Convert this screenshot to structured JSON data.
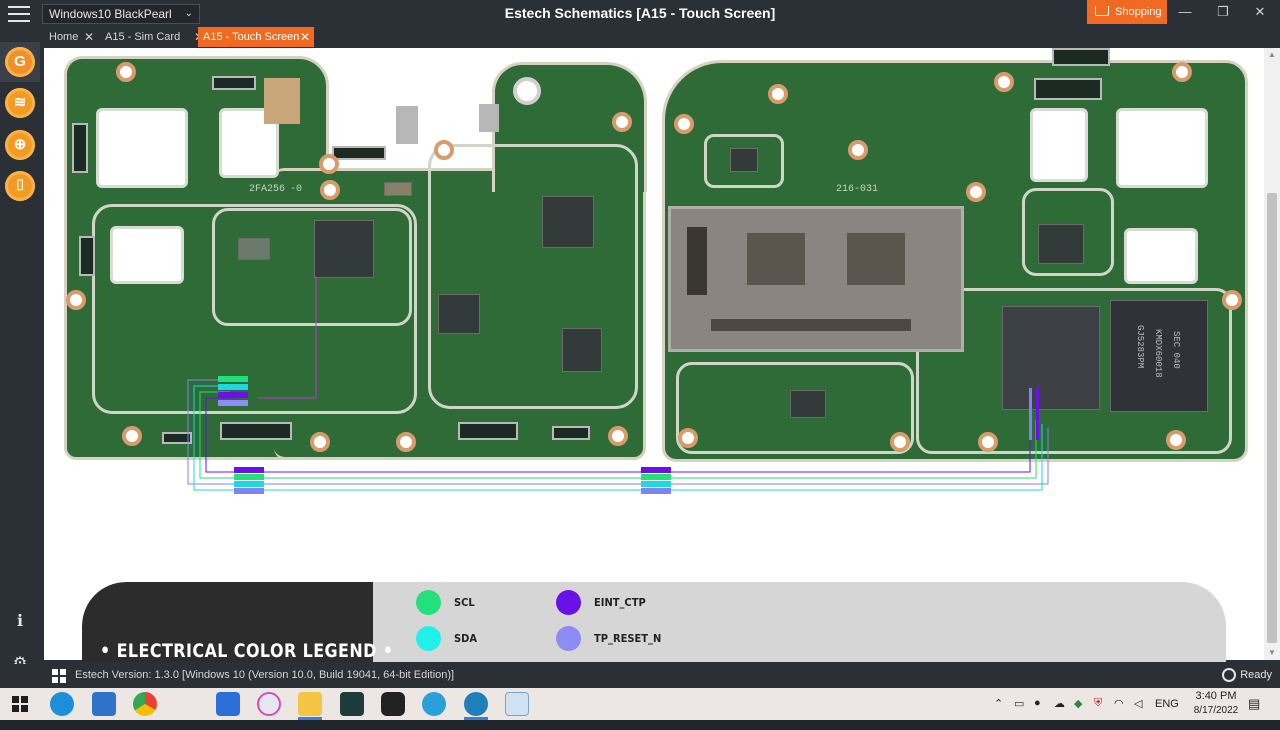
{
  "window": {
    "title": "Estech Schematics [A15 - Touch Screen]",
    "profile_select": "Windows10 BlackPearl",
    "shopping_label": "Shopping",
    "controls": {
      "minimize": "—",
      "maximize": "❐",
      "close": "✕"
    }
  },
  "tabs": [
    {
      "label": "Home",
      "active": false
    },
    {
      "label": "A15 - Sim Card",
      "active": false
    },
    {
      "label": "A15 - Touch Screen",
      "active": true
    }
  ],
  "sidebar": {
    "buttons": [
      "G",
      "≋",
      "⊕",
      "⌷"
    ],
    "bottom": {
      "info": "ℹ",
      "settings": "⚙"
    }
  },
  "board": {
    "silk_left_1": "2FA256",
    "silk_left_2": "-0",
    "silk_right_1": "216-031",
    "chip_mark_1": "SEC 040",
    "chip_mark_2": "KMDX60018",
    "chip_mark_3": "GJ5283PM"
  },
  "legend": {
    "title": "• ELECTRICAL COLOR LEGEND •",
    "items": [
      {
        "label": "SCL",
        "color": "#22e07a"
      },
      {
        "label": "SDA",
        "color": "#1ff0e8"
      },
      {
        "label": "EINT_CTP",
        "color": "#6a10e8"
      },
      {
        "label": "TP_RESET_N",
        "color": "#8d8cf2"
      }
    ]
  },
  "status": {
    "version": "Estech Version: 1.3.0 [Windows 10 (Version 10.0, Build 19041, 64-bit Edition)]",
    "ready": "Ready"
  },
  "taskbar": {
    "lang": "ENG",
    "time": "3:40 PM",
    "date": "8/17/2022",
    "apps": [
      "edge-icon",
      "mail-icon",
      "chrome-icon",
      "app3-icon",
      "itunes-icon",
      "explorer-icon",
      "app-arrow-icon",
      "app-obs-icon",
      "telegram-icon",
      "estech-icon",
      "app-screen-icon"
    ]
  },
  "colors": {
    "accent": "#f26a21",
    "pcb": "#2e6b36"
  }
}
